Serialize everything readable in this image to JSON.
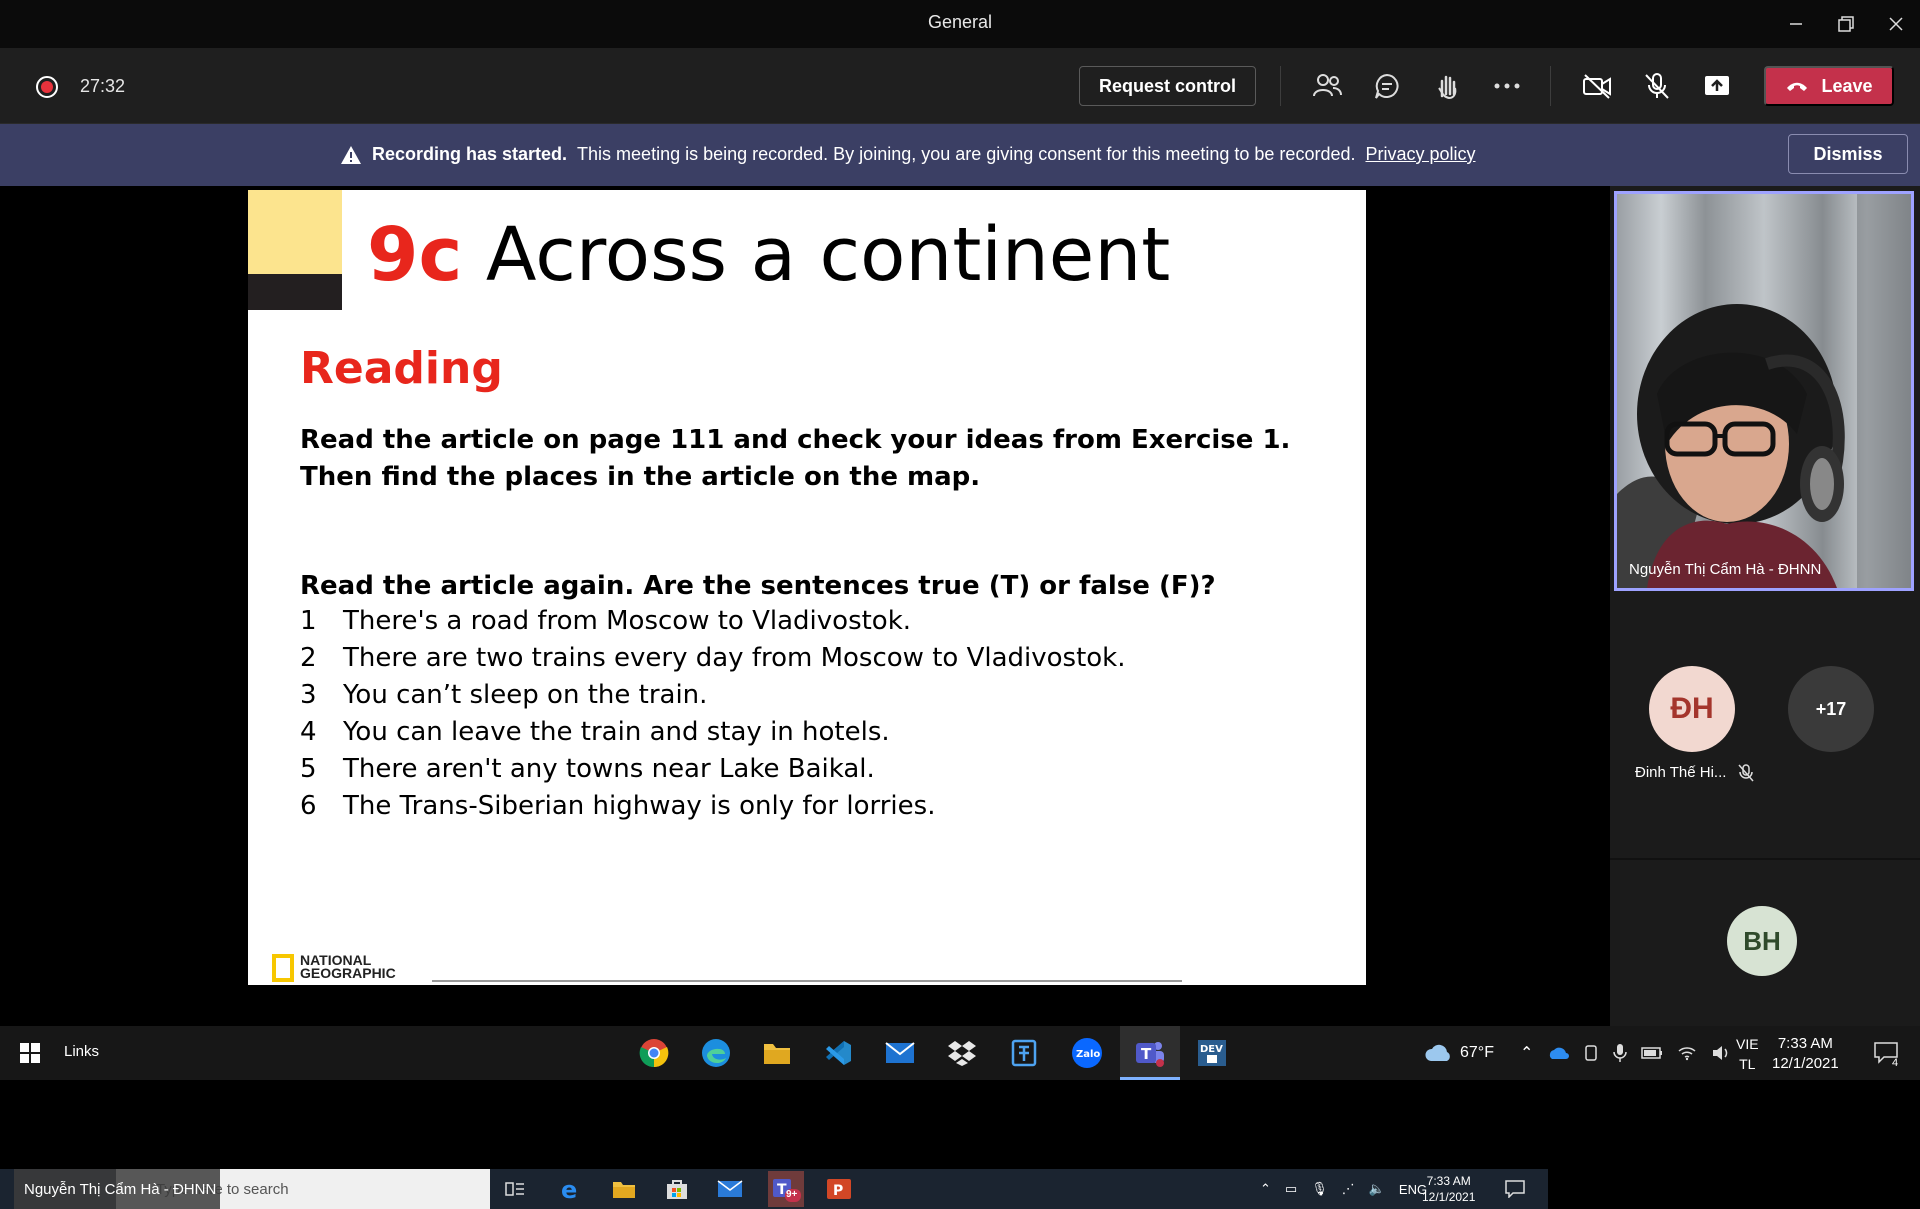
{
  "window": {
    "title": "General"
  },
  "toolbar": {
    "timer": "27:32",
    "request_control_label": "Request control",
    "leave_label": "Leave"
  },
  "banner": {
    "bold_text": "Recording has started.",
    "text": "This meeting is being recorded. By joining, you are giving consent for this meeting to be recorded.",
    "link": "Privacy policy",
    "dismiss_label": "Dismiss"
  },
  "slide": {
    "title_num": "9c",
    "title_text": "Across a continent",
    "section": "Reading",
    "instruction1": "Read the article on page 111 and check your ideas from Exercise 1. Then find the places in the article on the map.",
    "instruction2": "Read the article again. Are the sentences true (T) or false (F)?",
    "items": [
      {
        "num": "1",
        "text": "There's a road from Moscow to Vladivostok."
      },
      {
        "num": "2",
        "text": "There are two trains every day from Moscow to Vladivostok."
      },
      {
        "num": "3",
        "text": "You can’t sleep on the train."
      },
      {
        "num": "4",
        "text": "You can leave the train and stay in hotels."
      },
      {
        "num": "5",
        "text": "There aren't any towns near Lake Baikal."
      },
      {
        "num": "6",
        "text": "The Trans-Siberian highway is only for lorries."
      }
    ],
    "logo_line1": "NATIONAL",
    "logo_line2": "GEOGRAPHIC"
  },
  "remote_taskbar": {
    "presenter_label": "Nguyễn Thị Cẩm Hà - ĐHNN",
    "search_placeholder": "Type here to search",
    "teams_badge": "9+",
    "lang": "ENG",
    "time": "7:33 AM",
    "date": "12/1/2021"
  },
  "participants": {
    "video_name": "Nguyễn Thị Cẩm Hà - ĐHNN",
    "p1_initials": "ĐH",
    "p1_name": "Đinh Thế Hi...",
    "more_count": "+17",
    "p2_initials": "BH"
  },
  "taskbar": {
    "links_label": "Links",
    "weather": "67°F",
    "lang_line1": "VIE",
    "lang_line2": "TL",
    "time": "7:33 AM",
    "date": "12/1/2021",
    "notification_count": "4"
  },
  "colors": {
    "accent_red": "#c4314b",
    "banner_bg": "#3b3f64",
    "slide_red": "#e8261c",
    "active_border": "#9ea2ff"
  }
}
